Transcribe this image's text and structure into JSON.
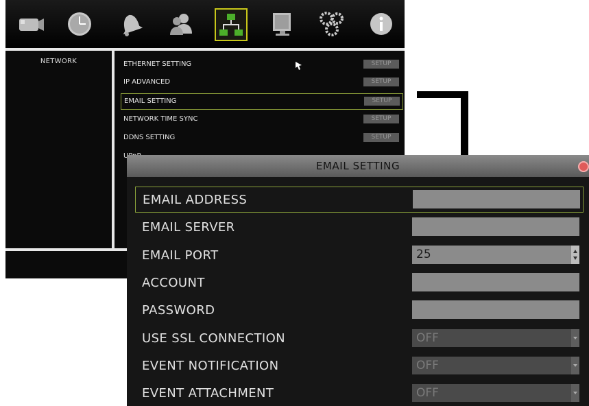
{
  "network_screen": {
    "left_panel_title": "NETWORK",
    "menu_items": [
      {
        "label": "ETHERNET SETTING",
        "button": "SETUP"
      },
      {
        "label": "IP ADVANCED",
        "button": "SETUP"
      },
      {
        "label": "EMAIL SETTING",
        "button": "SETUP"
      },
      {
        "label": "NETWORK TIME SYNC",
        "button": "SETUP"
      },
      {
        "label": "DDNS SETTING",
        "button": "SETUP"
      },
      {
        "label": "UPnP",
        "button": ""
      }
    ],
    "toolbar_icons": [
      "camera-icon",
      "clock-icon",
      "alarm-bell-icon",
      "users-icon",
      "network-icon",
      "monitor-icon",
      "gears-icon",
      "info-icon"
    ]
  },
  "email_dialog": {
    "title": "EMAIL SETTING",
    "fields": [
      {
        "label": "EMAIL ADDRESS",
        "value": ""
      },
      {
        "label": "EMAIL SERVER",
        "value": ""
      },
      {
        "label": "EMAIL PORT",
        "value": "25"
      },
      {
        "label": "ACCOUNT",
        "value": ""
      },
      {
        "label": "PASSWORD",
        "value": ""
      },
      {
        "label": "USE SSL CONNECTION",
        "value": "OFF"
      },
      {
        "label": "EVENT NOTIFICATION",
        "value": "OFF"
      },
      {
        "label": "EVENT ATTACHMENT",
        "value": "OFF"
      }
    ]
  },
  "colors": {
    "highlight_border": "#8aa23a",
    "active_icon_border": "#c9c81a"
  }
}
